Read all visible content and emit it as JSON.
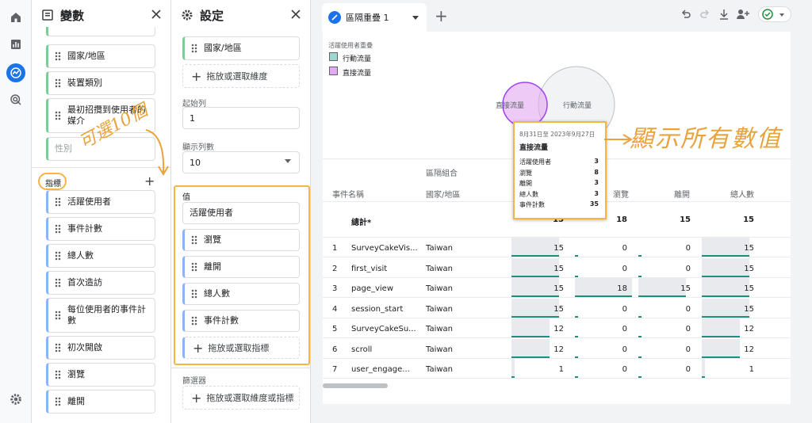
{
  "rail": {
    "icons": [
      "home-icon",
      "reports-icon",
      "explore-icon",
      "advertising-icon",
      "settings-icon"
    ]
  },
  "variables_panel": {
    "title": "變數",
    "dimensions": [
      "國家/地區",
      "裝置類別",
      "最初招攬到使用者的媒介",
      "性別"
    ],
    "metrics_label": "指標",
    "metrics": [
      "活躍使用者",
      "事件計數",
      "總人數",
      "首次造訪",
      "每位使用者的事件計數",
      "初次開啟",
      "瀏覽",
      "離開"
    ]
  },
  "settings_panel": {
    "title": "設定",
    "row_chip": "國家/地區",
    "drop_dimension": "拖放或選取維度",
    "start_row_label": "起始列",
    "start_row_value": "1",
    "show_rows_label": "顯示列數",
    "show_rows_value": "10",
    "values_label": "值",
    "values": [
      "活躍使用者",
      "瀏覽",
      "離開",
      "總人數",
      "事件計數"
    ],
    "drop_metric": "拖放或選取指標",
    "filters_label": "篩選器",
    "drop_filter": "拖放或選取維度或指標"
  },
  "annotations": {
    "optional_text": "可選10個",
    "show_all_text": "顯示所有數值"
  },
  "tab": {
    "label": "區隔重疊 1"
  },
  "venn": {
    "title": "活躍使用者重疊",
    "legend": [
      "行動流量",
      "直接流量"
    ],
    "small_label": "直接流量",
    "big_label": "行動流量",
    "colors": {
      "mobile": "#9fd6cf",
      "direct": "#e1a9f0"
    }
  },
  "tooltip": {
    "date": "8月31日至 2023年9月27日",
    "title": "直接流量",
    "rows": [
      {
        "k": "活躍使用者",
        "v": "3"
      },
      {
        "k": "瀏覽",
        "v": "8"
      },
      {
        "k": "離開",
        "v": "3"
      },
      {
        "k": "總人數",
        "v": "3"
      },
      {
        "k": "事件計數",
        "v": "35"
      }
    ]
  },
  "table": {
    "segment_header": "區隔組合",
    "col_event": "事件名稱",
    "col_country": "國家/地區",
    "metric_cols": [
      "瀏覽",
      "離開",
      "總人數"
    ],
    "total_label": "總計*",
    "total_values": [
      "15",
      "18",
      "15",
      "15"
    ],
    "rows": [
      {
        "n": "1",
        "event": "SurveyCakeVis...",
        "country": "Taiwan",
        "v": [
          "15",
          "0",
          "0",
          "15"
        ]
      },
      {
        "n": "2",
        "event": "first_visit",
        "country": "Taiwan",
        "v": [
          "15",
          "0",
          "0",
          "15"
        ]
      },
      {
        "n": "3",
        "event": "page_view",
        "country": "Taiwan",
        "v": [
          "15",
          "18",
          "15",
          "15"
        ]
      },
      {
        "n": "4",
        "event": "session_start",
        "country": "Taiwan",
        "v": [
          "15",
          "0",
          "0",
          "15"
        ]
      },
      {
        "n": "5",
        "event": "SurveyCakeSu...",
        "country": "Taiwan",
        "v": [
          "12",
          "0",
          "0",
          "12"
        ]
      },
      {
        "n": "6",
        "event": "scroll",
        "country": "Taiwan",
        "v": [
          "12",
          "0",
          "0",
          "12"
        ]
      },
      {
        "n": "7",
        "event": "user_engage...",
        "country": "Taiwan",
        "v": [
          "1",
          "0",
          "0",
          "1"
        ]
      }
    ]
  }
}
